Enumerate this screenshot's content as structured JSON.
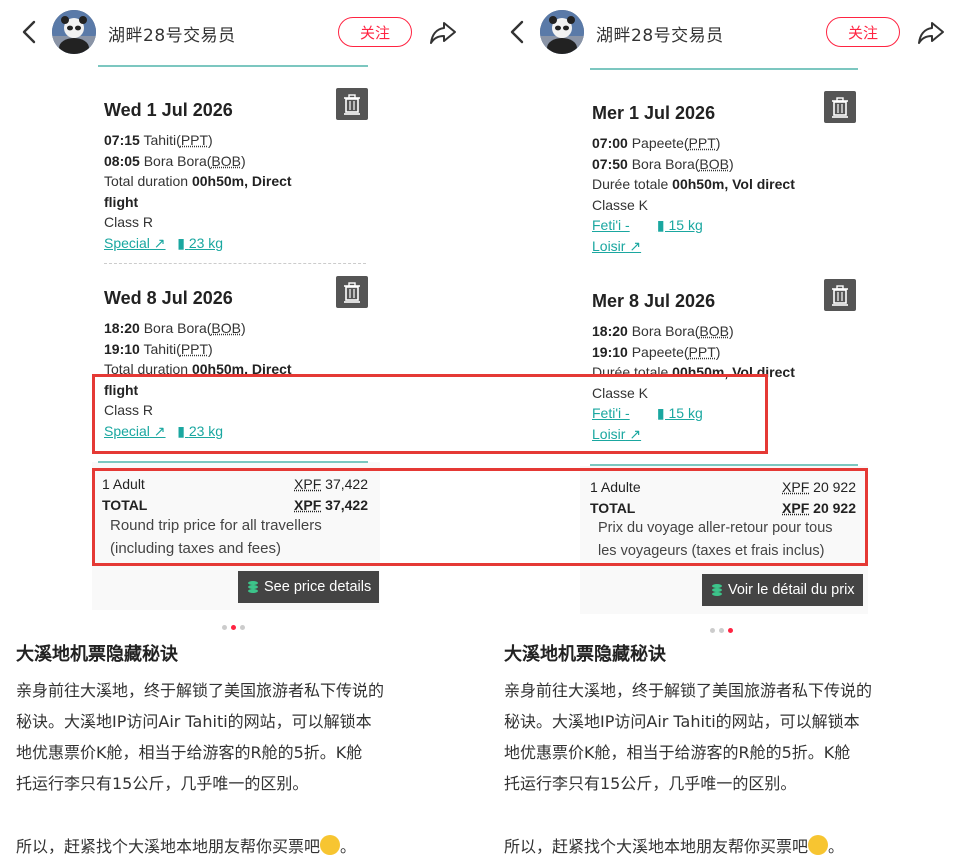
{
  "post": {
    "username": "湖畔28号交易员",
    "follow_label": "关注",
    "title": "大溪地机票隐藏秘诀",
    "body_lines": [
      "亲身前往大溪地，终于解锁了美国旅游者私下传说的",
      "秘诀。大溪地IP访问Air Tahiti的网站，可以解锁本",
      "地优惠票价K舱，相当于给游客的R舱的5折。K舱",
      "托运行李只有15公斤，几乎唯一的区别。"
    ],
    "closing": "所以，赶紧找个大溪地本地朋友帮你买票吧",
    "closing_end": "。"
  },
  "left_shot": {
    "flights": [
      {
        "date": "Wed 1 Jul 2026",
        "dep_time": "07:15",
        "dep_city": "Tahiti",
        "dep_code": "PPT",
        "arr_time": "08:05",
        "arr_city": "Bora Bora",
        "arr_code": "BOB",
        "duration_label": "Total duration",
        "duration": "00h50m, Direct",
        "duration_cont": "flight",
        "class": "Class R",
        "fare": "Special",
        "baggage": "23 kg"
      },
      {
        "date": "Wed 8 Jul 2026",
        "dep_time": "18:20",
        "dep_city": "Bora Bora",
        "dep_code": "BOB",
        "arr_time": "19:10",
        "arr_city": "Tahiti",
        "arr_code": "PPT",
        "duration_label": "Total duration",
        "duration": "00h50m, Direct",
        "duration_cont": "flight",
        "class": "Class R",
        "fare": "Special",
        "baggage": "23 kg"
      }
    ],
    "pax_label": "1 Adult",
    "total_label": "TOTAL",
    "currency": "XPF",
    "pax_amount": "37,422",
    "total_amount": "37,422",
    "note_lines": [
      "Round trip price for all travellers",
      "(including taxes and fees)"
    ],
    "details_button": "See price details",
    "active_dot": 1
  },
  "right_shot": {
    "flights": [
      {
        "date": "Mer 1 Jul 2026",
        "dep_time": "07:00",
        "dep_city": "Papeete",
        "dep_code": "PPT",
        "arr_time": "07:50",
        "arr_city": "Bora Bora",
        "arr_code": "BOB",
        "duration_label": "Durée totale",
        "duration": "00h50m, Vol direct",
        "class": "Classe K",
        "fare_line1": "Feti'i -",
        "fare_line2": "Loisir",
        "baggage": "15 kg"
      },
      {
        "date": "Mer 8 Jul 2026",
        "dep_time": "18:20",
        "dep_city": "Bora Bora",
        "dep_code": "BOB",
        "arr_time": "19:10",
        "arr_city": "Papeete",
        "arr_code": "PPT",
        "duration_label": "Durée totale",
        "duration": "00h50m, Vol direct",
        "class": "Classe K",
        "fare_line1": "Feti'i -",
        "fare_line2": "Loisir",
        "baggage": "15 kg"
      }
    ],
    "pax_label": "1 Adulte",
    "total_label": "TOTAL",
    "currency": "XPF",
    "pax_amount": "20 922",
    "total_amount": "20 922",
    "note_lines": [
      "Prix du voyage aller-retour pour tous",
      "les voyageurs (taxes et frais inclus)"
    ],
    "details_button": "Voir le détail du prix",
    "active_dot": 2
  },
  "colors": {
    "accent": "#ff2442",
    "teal": "#1aa7a0",
    "highlight": "#e53935"
  }
}
